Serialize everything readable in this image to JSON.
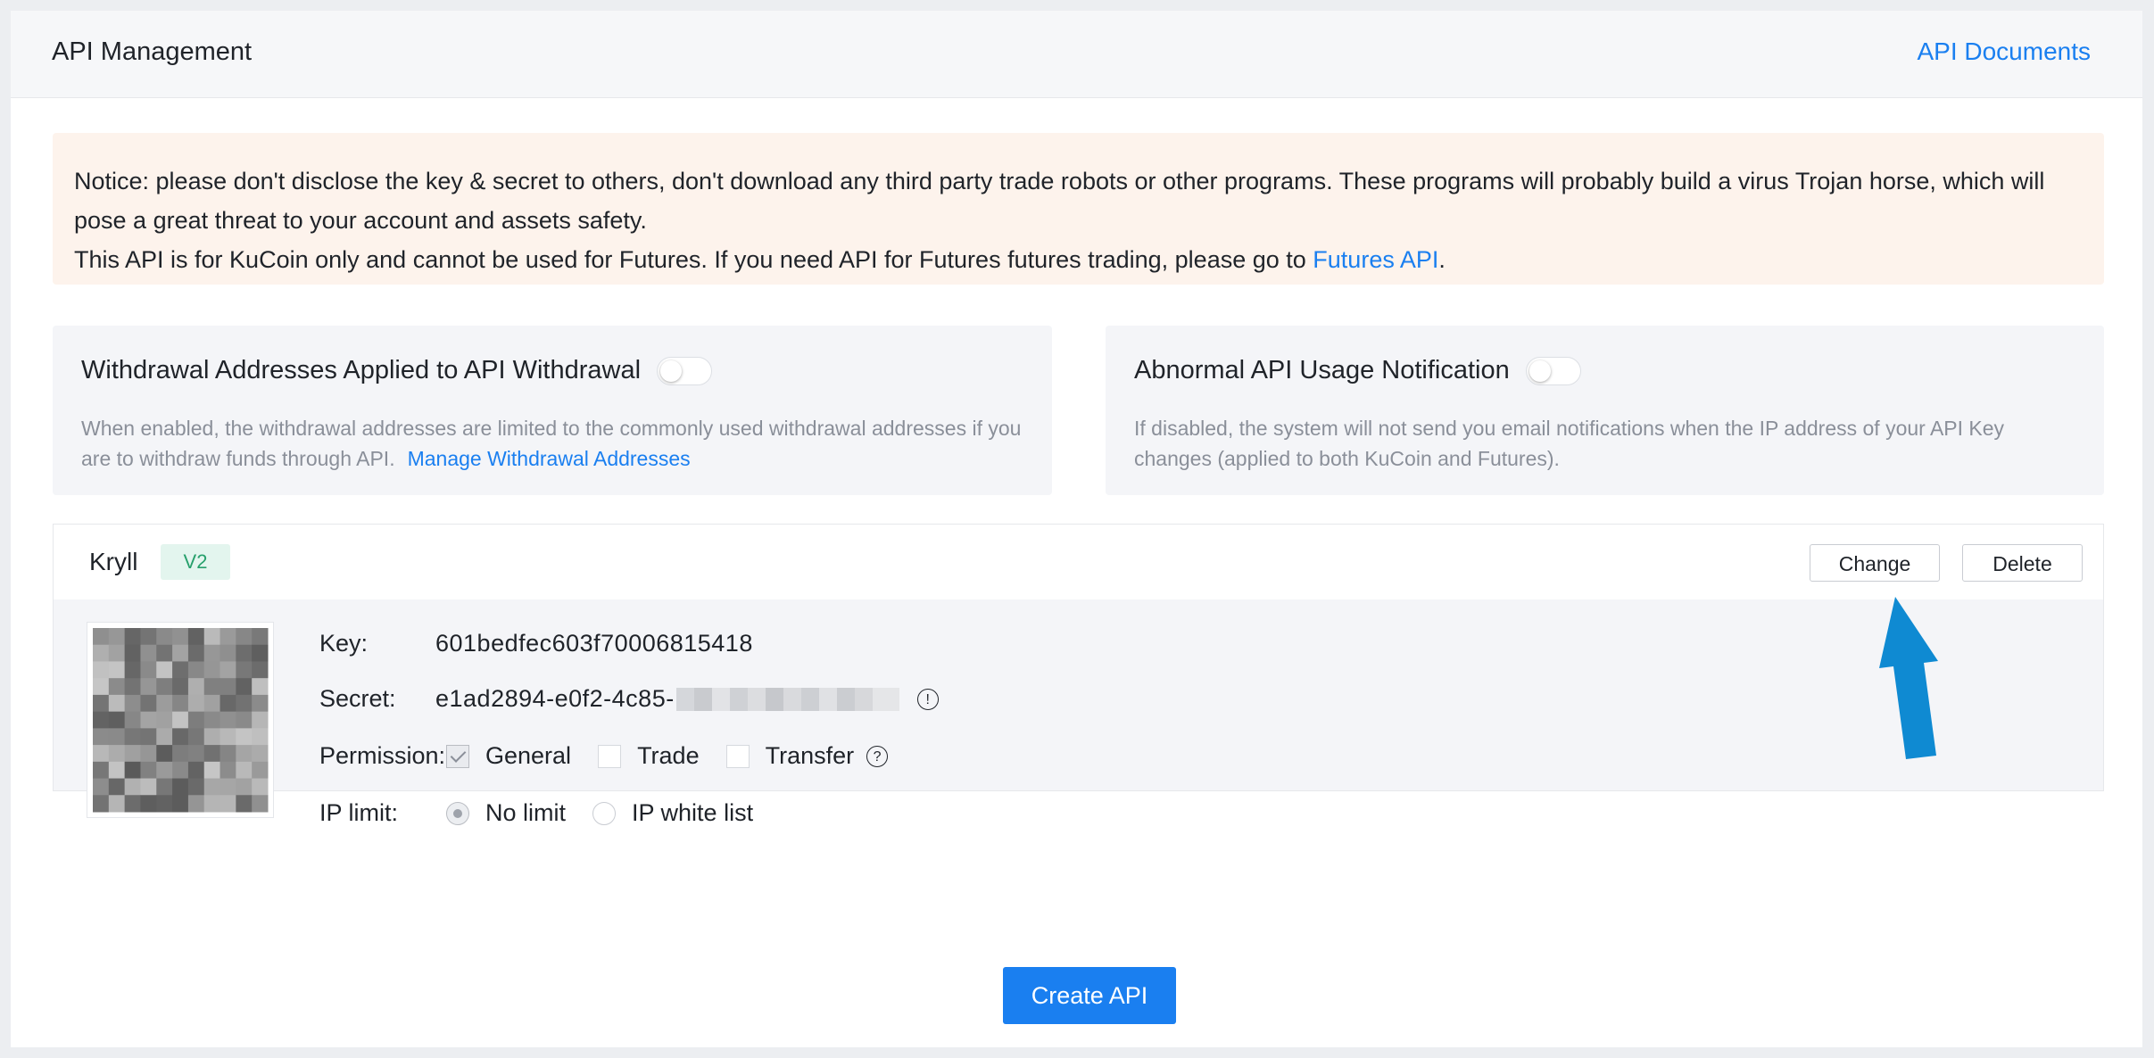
{
  "header": {
    "title": "API Management",
    "docs_link": "API Documents"
  },
  "notice": {
    "line1": "Notice: please don't disclose the key & secret to others, don't download any third party trade robots or other programs. These programs will probably build a virus Trojan horse, which will pose a great threat to your account and assets safety.",
    "line2_prefix": "This API is for KuCoin only and cannot be used for Futures. If you need API for Futures futures trading, please go to ",
    "line2_link": "Futures API",
    "line2_suffix": "."
  },
  "withdrawal_card": {
    "title": "Withdrawal Addresses Applied to API Withdrawal",
    "toggle_on": false,
    "desc": "When enabled, the withdrawal addresses are limited to the commonly used withdrawal addresses if you are to withdraw funds through API.",
    "link": "Manage Withdrawal Addresses"
  },
  "notification_card": {
    "title": "Abnormal API Usage Notification",
    "toggle_on": false,
    "desc": "If disabled, the system will not send you email notifications when the IP address of your API Key changes (applied to both KuCoin and Futures)."
  },
  "api_item": {
    "name": "Kryll",
    "version_badge": "V2",
    "change_label": "Change",
    "delete_label": "Delete",
    "key_label": "Key:",
    "key_value": "601bedfec603f70006815418",
    "secret_label": "Secret:",
    "secret_value": "e1ad2894-e0f2-4c85-",
    "info_glyph": "!",
    "permission_label": "Permission:",
    "permissions": [
      {
        "label": "General",
        "checked": true
      },
      {
        "label": "Trade",
        "checked": false
      },
      {
        "label": "Transfer",
        "checked": false
      }
    ],
    "help_glyph": "?",
    "ip_label": "IP limit:",
    "ip_options": [
      {
        "label": "No limit",
        "selected": true
      },
      {
        "label": "IP white list",
        "selected": false
      }
    ]
  },
  "create_button": "Create API",
  "colors": {
    "accent": "#1a7ff0",
    "badge_green": "#27a06c",
    "notice_bg": "#fdf3ec",
    "arrow": "#0f8ad2"
  }
}
